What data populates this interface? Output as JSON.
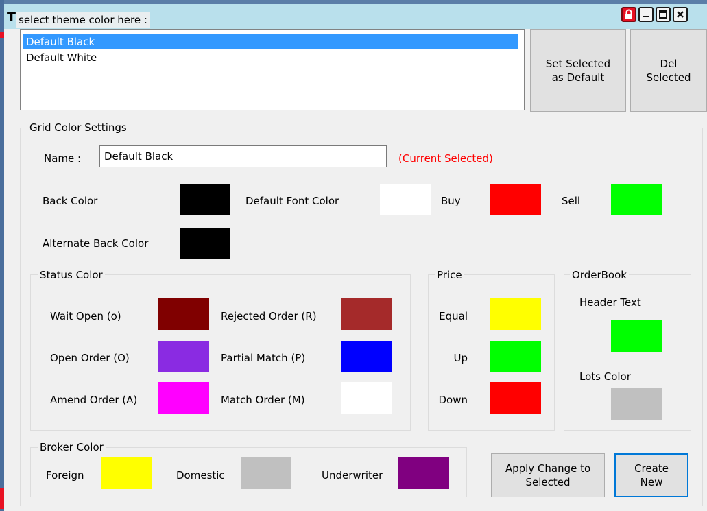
{
  "window": {
    "title_letter": "T",
    "theme_hint": "select theme color here :"
  },
  "themes": {
    "items": [
      {
        "label": "Default Black",
        "selected": true
      },
      {
        "label": "Default White",
        "selected": false
      }
    ]
  },
  "buttons": {
    "set_default": "Set Selected as Default",
    "del_selected": "Del Selected",
    "apply_change": "Apply Change to Selected",
    "create_new": "Create New"
  },
  "grid": {
    "group_title": "Grid Color Settings",
    "name_label": "Name :",
    "name_value": "Default Black",
    "current_note": "(Current Selected)",
    "back_color_label": "Back Color",
    "default_font_color_label": "Default Font Color",
    "buy_label": "Buy",
    "sell_label": "Sell",
    "alt_back_color_label": "Alternate Back Color"
  },
  "status": {
    "group_title": "Status Color",
    "wait_open": "Wait Open (o)",
    "rejected_order": "Rejected Order (R)",
    "open_order": "Open Order (O)",
    "partial_match": "Partial Match (P)",
    "amend_order": "Amend Order (A)",
    "match_order": "Match Order (M)"
  },
  "price": {
    "group_title": "Price",
    "equal": "Equal",
    "up": "Up",
    "down": "Down"
  },
  "orderbook": {
    "group_title": "OrderBook",
    "header_text": "Header Text",
    "lots_color": "Lots Color"
  },
  "broker": {
    "group_title": "Broker Color",
    "foreign": "Foreign",
    "domestic": "Domestic",
    "underwriter": "Underwriter"
  },
  "colors": {
    "back": "#000000",
    "default_font": "#ffffff",
    "buy": "#ff0000",
    "sell": "#00ff00",
    "alt_back": "#000000",
    "wait_open": "#800000",
    "rejected_order": "#a52a2a",
    "open_order": "#8a2be2",
    "partial_match": "#0000ff",
    "amend_order": "#ff00ff",
    "match_order": "#ffffff",
    "price_equal": "#ffff00",
    "price_up": "#00ff00",
    "price_down": "#ff0000",
    "ob_header_text": "#00ff00",
    "ob_lots": "#c0c0c0",
    "broker_foreign": "#ffff00",
    "broker_domestic": "#c0c0c0",
    "broker_underwriter": "#800080",
    "current_note": "#ff0000",
    "selection": "#3399ff"
  },
  "icons": {
    "lock": "lock-icon",
    "minimize": "minimize-icon",
    "maximize": "maximize-icon",
    "close": "close-icon"
  }
}
